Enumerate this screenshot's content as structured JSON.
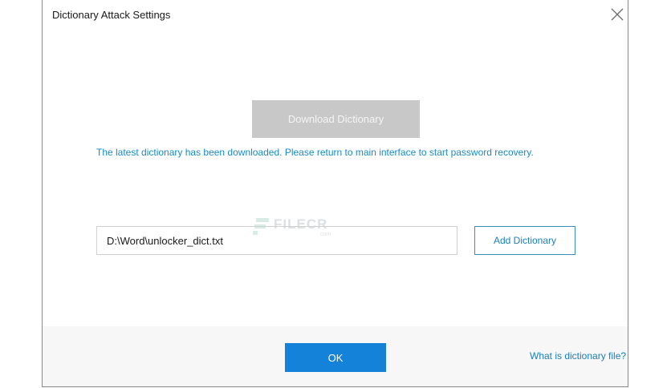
{
  "window": {
    "title": "Dictionary Attack Settings"
  },
  "download": {
    "label": "Download Dictionary",
    "status_message": "The latest dictionary has been downloaded. Please return to main interface to start password recovery."
  },
  "watermark": {
    "text": "FILECR",
    "sub": ".com"
  },
  "dictionary": {
    "path_value": "D:\\Word\\unlocker_dict.txt",
    "add_label": "Add Dictionary"
  },
  "footer": {
    "ok_label": "OK",
    "help_link": "What is dictionary file?"
  },
  "colors": {
    "accent": "#1482d8",
    "link": "#1a7fb8",
    "disabled_button": "#c8c8c8"
  },
  "icons": {
    "close": "close-icon"
  }
}
